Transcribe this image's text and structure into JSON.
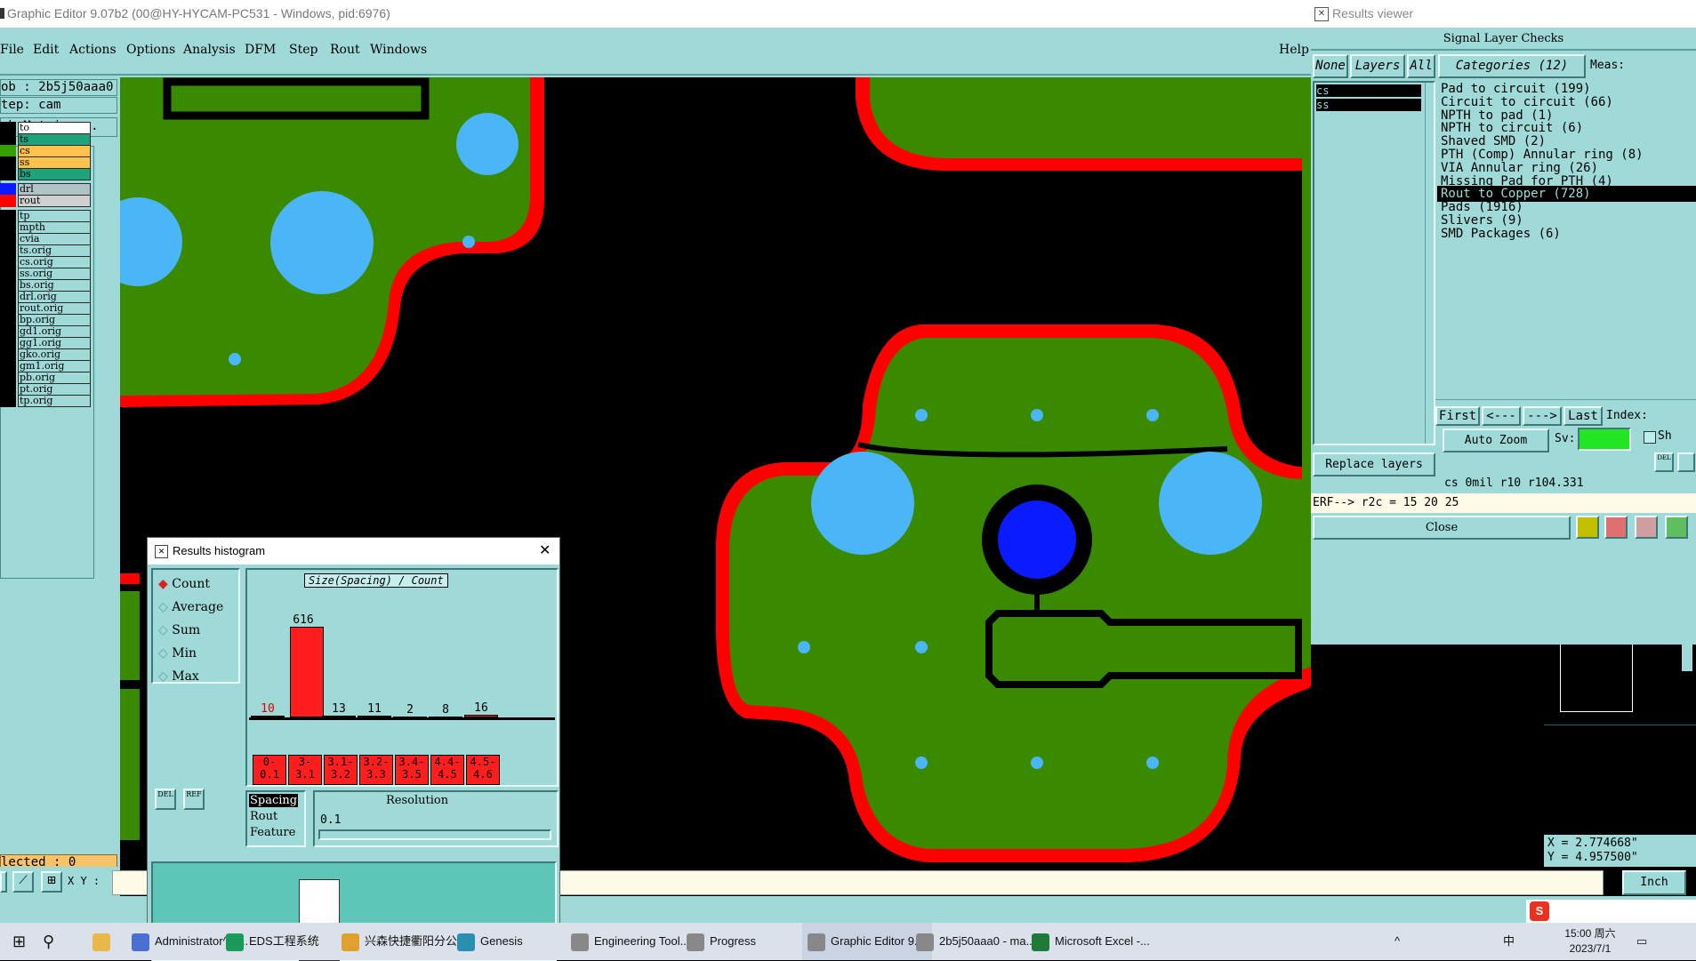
{
  "window": {
    "title": "Graphic Editor 9.07b2 (00@HY-HYCAM-PC531 - Windows, pid:6976)",
    "menu": [
      "File",
      "Edit",
      "Actions",
      "Options",
      "Analysis",
      "DFM",
      "Step",
      "Rout",
      "Windows"
    ],
    "help": "Help"
  },
  "left_panel": {
    "job": "ob : 2b5j50aaa0",
    "step": "tep: cam",
    "matrix_button": "ob Matrix ...",
    "layers_top": [
      {
        "name": "to",
        "color": "#ffffff",
        "swatch": "#000000"
      },
      {
        "name": "ts",
        "color": "#1ea37c",
        "swatch": "#000000"
      },
      {
        "name": "cs",
        "color": "#ffc34d",
        "swatch": "#36a000"
      },
      {
        "name": "ss",
        "color": "#ffc34d",
        "swatch": "#000000"
      },
      {
        "name": "bs",
        "color": "#1ea37c",
        "swatch": "#000000"
      }
    ],
    "layers_drill": [
      {
        "name": "drl",
        "color": "#b0c4c8",
        "swatch": "#0a1cff"
      },
      {
        "name": "rout",
        "color": "#d0d0d0",
        "swatch": "#ff0000"
      }
    ],
    "layers_misc": [
      "tp",
      "mpth",
      "cvia",
      "ts.orig",
      "cs.orig",
      "ss.orig",
      "bs.orig",
      "drl.orig",
      "rout.orig",
      "bp.orig",
      "gd1.orig",
      "gg1.orig",
      "gko.orig",
      "gm1.orig",
      "pb.orig",
      "pt.orig",
      "tp.orig"
    ],
    "selected": "lected : 0",
    "xy_label": "X Y :"
  },
  "results_viewer": {
    "title": "Results viewer",
    "header": "Signal Layer Checks",
    "none_btn": "None",
    "layers_btn": "Layers",
    "all_btn": "All",
    "categories_btn": "Categories (12)",
    "meas_label": "Meas:",
    "layer_list": [
      "cs",
      "ss"
    ],
    "categories": [
      "Pad to circuit (199)",
      "Circuit to circuit (66)",
      "NPTH to pad (1)",
      "NPTH to circuit (6)",
      "Shaved SMD (2)",
      "PTH (Comp) Annular ring (8)",
      "VIA Annular ring (26)",
      "Missing Pad for PTH (4)",
      "Rout to Copper (728)",
      "Pads (1916)",
      "Slivers (9)",
      "SMD Packages (6)"
    ],
    "selected_category": "Rout to Copper (728)",
    "nav": [
      "First",
      "<---",
      "--->",
      "Last"
    ],
    "index_label": "Index:",
    "auto_zoom": "Auto Zoom",
    "sv_label": "Sv:",
    "replace_layers": "Replace layers",
    "status_line": "cs  0mil  r10  r104.331",
    "erf_line": "ERF--> r2c = 15 20 25",
    "close_btn": "Close",
    "coord_x": "X = 2.774668\"",
    "coord_y": "Y = 4.957500\"",
    "units": "Inch"
  },
  "histogram": {
    "title": "Results histogram",
    "modes": [
      "Count",
      "Average",
      "Sum",
      "Min",
      "Max"
    ],
    "selected_mode": "Count",
    "chart_label": "Size(Spacing) / Count",
    "bins": [
      {
        "range": "0-\n0.1",
        "count": 10
      },
      {
        "range": "3-\n3.1",
        "count": 616
      },
      {
        "range": "3.1-\n3.2",
        "count": 13
      },
      {
        "range": "3.2-\n3.3",
        "count": 11
      },
      {
        "range": "3.4-\n3.5",
        "count": 2
      },
      {
        "range": "4.4-\n4.5",
        "count": 8
      },
      {
        "range": "4.5-\n4.6",
        "count": 16
      }
    ],
    "types": [
      "Spacing",
      "Rout",
      "Feature"
    ],
    "selected_type": "Spacing",
    "resolution_label": "Resolution",
    "resolution_value": "0.1"
  },
  "taskbar": {
    "items": [
      "Administrator^ - ...",
      "EDS工程系统",
      "兴森快捷衢阳分公...",
      "Genesis",
      "Engineering Tool...",
      "Progress",
      "Graphic Editor 9....",
      "2b5j50aaa0 - ma...",
      "Microsoft Excel -..."
    ],
    "time": "15:00 周六",
    "date": "2023/7/1",
    "ime": "中"
  }
}
